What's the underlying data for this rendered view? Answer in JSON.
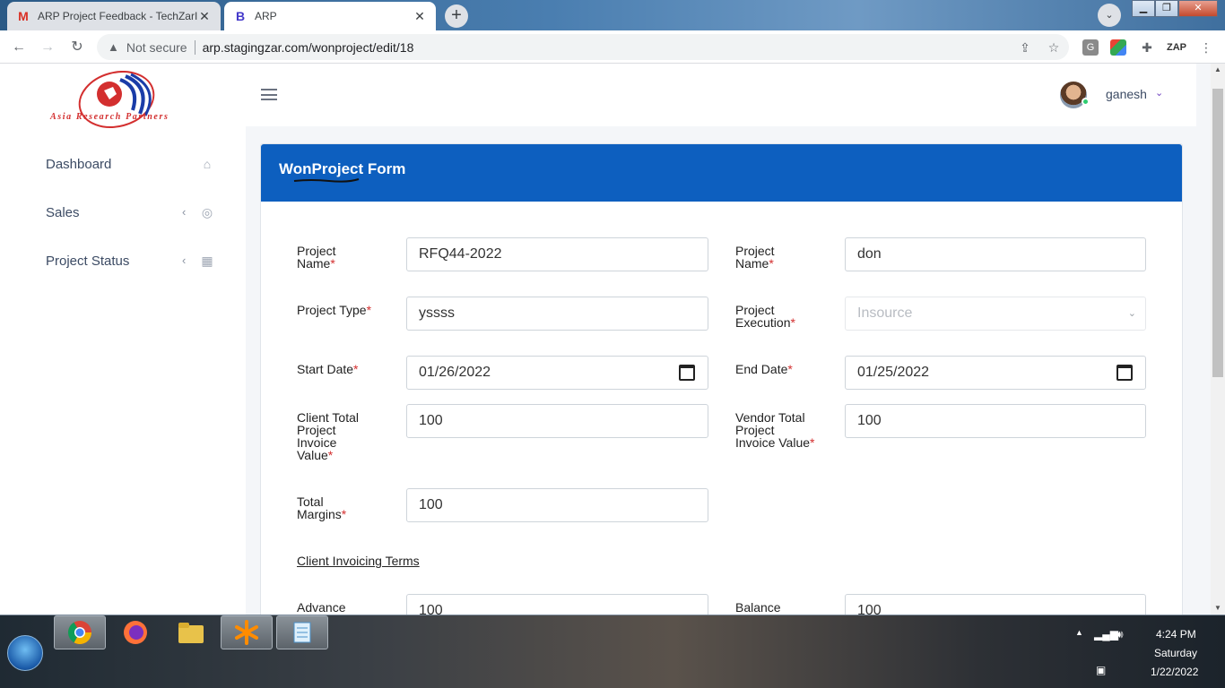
{
  "browser": {
    "tabs": [
      {
        "title": "ARP Project Feedback - TechZarInfo",
        "icon": "gmail-icon",
        "active": false
      },
      {
        "title": "ARP",
        "icon": "bootstrap-icon",
        "active": true
      }
    ],
    "security_label": "Not secure",
    "url": "arp.stagingzar.com/wonproject/edit/18"
  },
  "sidebar": {
    "logo_text": "Asia Research Partners",
    "items": [
      {
        "label": "Dashboard",
        "icon": "home-icon",
        "has_arrow": false
      },
      {
        "label": "Sales",
        "icon": "target-icon",
        "has_arrow": true
      },
      {
        "label": "Project Status",
        "icon": "grid-icon",
        "has_arrow": true
      }
    ]
  },
  "header": {
    "username": "ganesh"
  },
  "form": {
    "title": "WonProject Form",
    "required_mark": "*",
    "fields": {
      "project_name_left": {
        "label": "Project Name",
        "value": "RFQ44-2022"
      },
      "project_name_right": {
        "label": "Project Name",
        "value": "don"
      },
      "project_type": {
        "label": "Project Type",
        "value": "yssss"
      },
      "project_execution": {
        "label": "Project Execution",
        "value": "Insource"
      },
      "start_date": {
        "label": "Start Date",
        "value": "01/26/2022"
      },
      "end_date": {
        "label": "End Date",
        "value": "01/25/2022"
      },
      "client_total": {
        "label": "Client Total Project Invoice Value",
        "value": "100"
      },
      "vendor_total": {
        "label": "Vendor Total Project Invoice Value",
        "value": "100"
      },
      "total_margins": {
        "label": "Total Margins",
        "value": "100"
      },
      "advance": {
        "label": "Advance",
        "value": "100"
      },
      "balance": {
        "label": "Balance",
        "value": "100"
      }
    },
    "section_client_invoicing": "Client Invoicing Terms"
  },
  "taskbar": {
    "apps": [
      "chrome-icon",
      "firefox-icon",
      "folder-icon",
      "asterisk-app-icon",
      "notepad-icon"
    ],
    "time": "4:24 PM",
    "day": "Saturday",
    "date": "1/22/2022"
  },
  "colors": {
    "card_header": "#0d5fbf",
    "required": "#d32f2f",
    "page_bg": "#f4f6f9"
  }
}
